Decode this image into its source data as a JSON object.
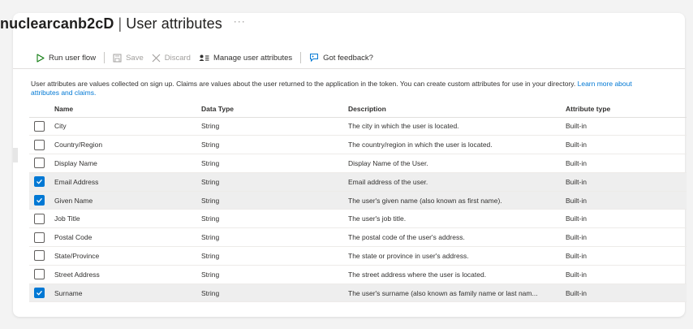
{
  "header": {
    "tenant": "nuclearcanb2cD",
    "separator": "|",
    "title": "User attributes",
    "more": "···"
  },
  "toolbar": {
    "run_user_flow": "Run user flow",
    "save": "Save",
    "discard": "Discard",
    "manage_user_attributes": "Manage user attributes",
    "got_feedback": "Got feedback?"
  },
  "info": {
    "text": "User attributes are values collected on sign up. Claims are values about the user returned to the application in the token. You can create custom attributes for use in your directory.",
    "link_part1": "Learn more about",
    "link_part2": "attributes and claims."
  },
  "table": {
    "headers": {
      "name": "Name",
      "data_type": "Data Type",
      "description": "Description",
      "attribute_type": "Attribute type"
    },
    "rows": [
      {
        "name": "City",
        "data_type": "String",
        "description": "The city in which the user is located.",
        "attribute_type": "Built-in",
        "checked": false
      },
      {
        "name": "Country/Region",
        "data_type": "String",
        "description": "The country/region in which the user is located.",
        "attribute_type": "Built-in",
        "checked": false
      },
      {
        "name": "Display Name",
        "data_type": "String",
        "description": "Display Name of the User.",
        "attribute_type": "Built-in",
        "checked": false
      },
      {
        "name": "Email Address",
        "data_type": "String",
        "description": "Email address of the user.",
        "attribute_type": "Built-in",
        "checked": true
      },
      {
        "name": "Given Name",
        "data_type": "String",
        "description": "The user's given name (also known as first name).",
        "attribute_type": "Built-in",
        "checked": true
      },
      {
        "name": "Job Title",
        "data_type": "String",
        "description": "The user's job title.",
        "attribute_type": "Built-in",
        "checked": false
      },
      {
        "name": "Postal Code",
        "data_type": "String",
        "description": "The postal code of the user's address.",
        "attribute_type": "Built-in",
        "checked": false
      },
      {
        "name": "State/Province",
        "data_type": "String",
        "description": "The state or province in user's address.",
        "attribute_type": "Built-in",
        "checked": false
      },
      {
        "name": "Street Address",
        "data_type": "String",
        "description": "The street address where the user is located.",
        "attribute_type": "Built-in",
        "checked": false
      },
      {
        "name": "Surname",
        "data_type": "String",
        "description": "The user's surname (also known as family name or last nam...",
        "attribute_type": "Built-in",
        "checked": true
      }
    ]
  },
  "colors": {
    "accent": "#0078d4",
    "run_icon": "#107c10",
    "selected_row": "#eeeeee"
  }
}
